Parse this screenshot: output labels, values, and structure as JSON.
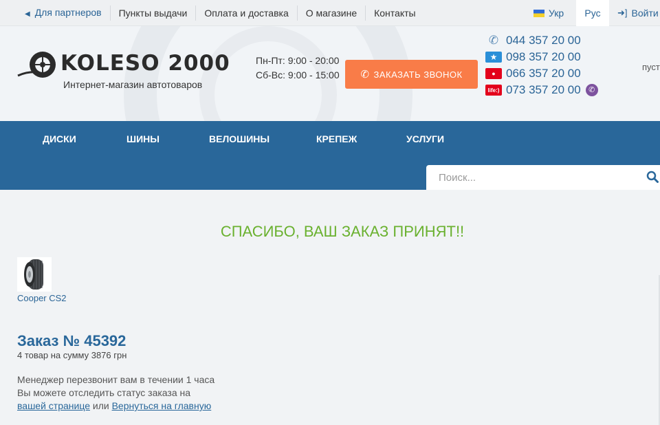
{
  "topbar": {
    "nav": [
      "Для партнеров",
      "Пункты выдачи",
      "Оплата и доставка",
      "О магазине",
      "Контакты"
    ],
    "lang_ukr": "Укр",
    "lang_rus": "Рус",
    "login": "Войти"
  },
  "header": {
    "logo_text": "KOLESO 2000",
    "logo_sub": "Интернет-магазин автотоваров",
    "hours": [
      "Пн-Пт: 9:00 - 20:00",
      "Сб-Вс: 9:00 - 15:00"
    ],
    "call_button": "ЗАКАЗАТЬ ЗВОНОК",
    "phones": [
      "044 357 20 00",
      "098 357 20 00",
      "066 357 20 00",
      "073 357 20 00"
    ],
    "cart_text": "пуст"
  },
  "mainnav": {
    "items": [
      "ДИСКИ",
      "ШИНЫ",
      "ВЕЛОШИНЫ",
      "КРЕПЕЖ",
      "УСЛУГИ"
    ],
    "search_placeholder": "Поиск..."
  },
  "content": {
    "success": "СПАСИБО, ВАШ ЗАКАЗ ПРИНЯТ!!",
    "product_name": "Cooper CS2",
    "order_title": "Заказ № 45392",
    "order_sum": "4 товар на сумму 3876 грн",
    "info_line1": "Менеджер перезвонит вам в течении 1 часа",
    "info_line2": "Вы можете отследить статус заказа на",
    "link_page": "вашей странице",
    "or_text": "или",
    "link_home": "Вернуться на главную"
  },
  "colors": {
    "accent": "#29679a",
    "callbutton": "#f97c48",
    "success": "#6ab12f"
  }
}
